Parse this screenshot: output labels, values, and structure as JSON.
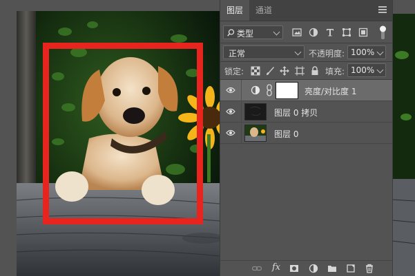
{
  "panel": {
    "tabs": [
      {
        "label": "图层",
        "active": true
      },
      {
        "label": "通道",
        "active": false
      }
    ],
    "filter": {
      "kind_label": "类型",
      "icons": [
        "image-filter-icon",
        "adjustment-filter-icon",
        "type-filter-icon",
        "shape-filter-icon",
        "smart-object-filter-icon",
        "filter-toggle-icon"
      ]
    },
    "blend_mode": "正常",
    "opacity": {
      "label": "不透明度:",
      "value": "100%"
    },
    "lock": {
      "label": "锁定:",
      "icons": [
        "lock-transparent-icon",
        "lock-paint-icon",
        "lock-move-icon",
        "lock-artboard-icon",
        "lock-all-icon"
      ]
    },
    "fill": {
      "label": "填充:",
      "value": "100%"
    },
    "layers": [
      {
        "name": "亮度/对比度 1",
        "type": "adjustment",
        "selected": true
      },
      {
        "name": "图层 0 拷贝",
        "type": "pixel",
        "selected": false
      },
      {
        "name": "图层 0",
        "type": "pixel",
        "selected": false
      }
    ],
    "bottom_icons": [
      "link-layers-icon",
      "fx-icon",
      "add-mask-icon",
      "new-adjustment-icon",
      "new-group-icon",
      "new-layer-icon",
      "delete-layer-icon"
    ],
    "fx_label": "fx"
  },
  "colors": {
    "panel_bg": "#535353",
    "selected_layer": "#6b6b6b",
    "frame_red": "#e8241f"
  }
}
